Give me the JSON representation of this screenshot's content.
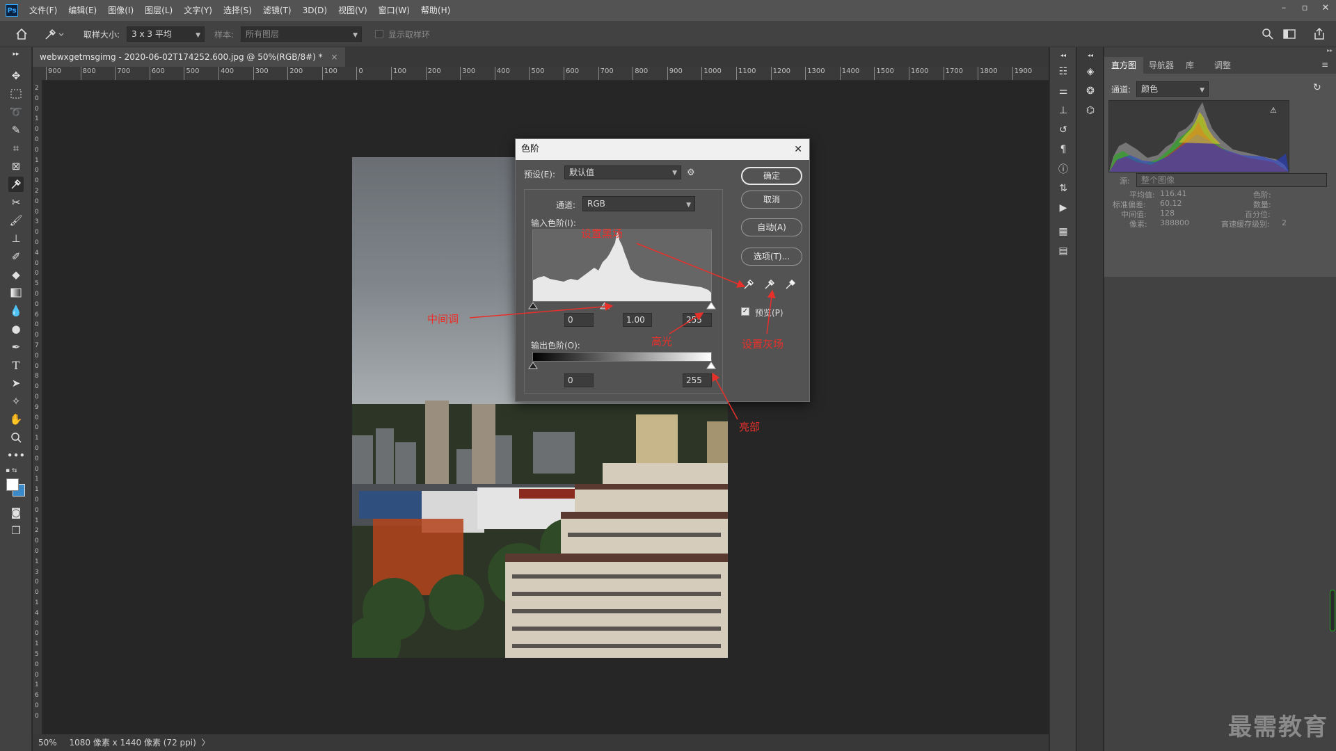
{
  "app": {
    "logo": "Ps"
  },
  "menubar": {
    "items": [
      "文件(F)",
      "编辑(E)",
      "图像(I)",
      "图层(L)",
      "文字(Y)",
      "选择(S)",
      "滤镜(T)",
      "3D(D)",
      "视图(V)",
      "窗口(W)",
      "帮助(H)"
    ],
    "window_controls": {
      "minimize": "–",
      "restore": "▫",
      "close": "✕"
    }
  },
  "options": {
    "sample_size_label": "取样大小:",
    "sample_size_value": "3 x 3 平均",
    "sample_label": "样本:",
    "sample_value": "所有图层",
    "show_ring_label": "显示取样环"
  },
  "document": {
    "tab_title": "webwxgetmsgimg - 2020-06-02T174252.600.jpg @ 50%(RGB/8#) *",
    "tab_close": "×",
    "ruler_h": [
      "900",
      "800",
      "700",
      "600",
      "500",
      "400",
      "300",
      "200",
      "100",
      "0",
      "100",
      "200",
      "300",
      "400",
      "500",
      "600",
      "700",
      "800",
      "900",
      "1000",
      "1100",
      "1200",
      "1300",
      "1400",
      "1500",
      "1600",
      "1700",
      "1800",
      "1900"
    ],
    "ruler_v": [
      "2",
      "0",
      "0",
      "1",
      "0",
      "0",
      "0",
      "1",
      "0",
      "0",
      "2",
      "0",
      "0",
      "3",
      "0",
      "0",
      "4",
      "0",
      "0",
      "5",
      "0",
      "0",
      "6",
      "0",
      "0",
      "7",
      "0",
      "0",
      "8",
      "0",
      "0",
      "9",
      "0",
      "0",
      "1",
      "0",
      "0",
      "0",
      "1",
      "1",
      "0",
      "0",
      "1",
      "2",
      "0",
      "0",
      "1",
      "3",
      "0",
      "0",
      "1",
      "4",
      "0",
      "0",
      "1",
      "5",
      "0",
      "0",
      "1",
      "6",
      "0",
      "0"
    ]
  },
  "status": {
    "zoom": "50%",
    "info": "1080 像素 x 1440 像素 (72 ppi)",
    "arrow": "〉"
  },
  "panel": {
    "tabs": [
      "直方图",
      "导航器",
      "库",
      "调整"
    ],
    "channel_label": "通道:",
    "channel_value": "颜色",
    "source_label": "源:",
    "source_value": "整个图像",
    "stats": {
      "mean_label": "平均值:",
      "mean": "116.41",
      "std_label": "标准偏差:",
      "std": "60.12",
      "median_label": "中间值:",
      "median": "128",
      "pixels_label": "像素:",
      "pixels": "388800",
      "level_label": "色阶:",
      "count_label": "数量:",
      "percentile_label": "百分位:",
      "cache_label": "高速缓存级别:",
      "cache": "2"
    }
  },
  "dialog": {
    "title": "色阶",
    "close": "✕",
    "preset_label": "预设(E):",
    "preset_value": "默认值",
    "channel_label": "通道:",
    "channel_value": "RGB",
    "input_label": "输入色阶(I):",
    "input_black": "0",
    "input_mid": "1.00",
    "input_white": "255",
    "output_label": "输出色阶(O):",
    "output_black": "0",
    "output_white": "255",
    "ok": "确定",
    "cancel": "取消",
    "auto": "自动(A)",
    "options": "选项(T)...",
    "preview_label": "预览(P)",
    "preview_checked": true
  },
  "annotations": {
    "black_point": "设置黑场",
    "midtone": "中间调",
    "highlight": "高光",
    "gray_point": "设置灰场",
    "bright": "亮部"
  },
  "watermark": "最需教育",
  "colors": {
    "accent": "#31a8ff",
    "annotation": "#e8302a",
    "dialog_bg": "#535353"
  }
}
